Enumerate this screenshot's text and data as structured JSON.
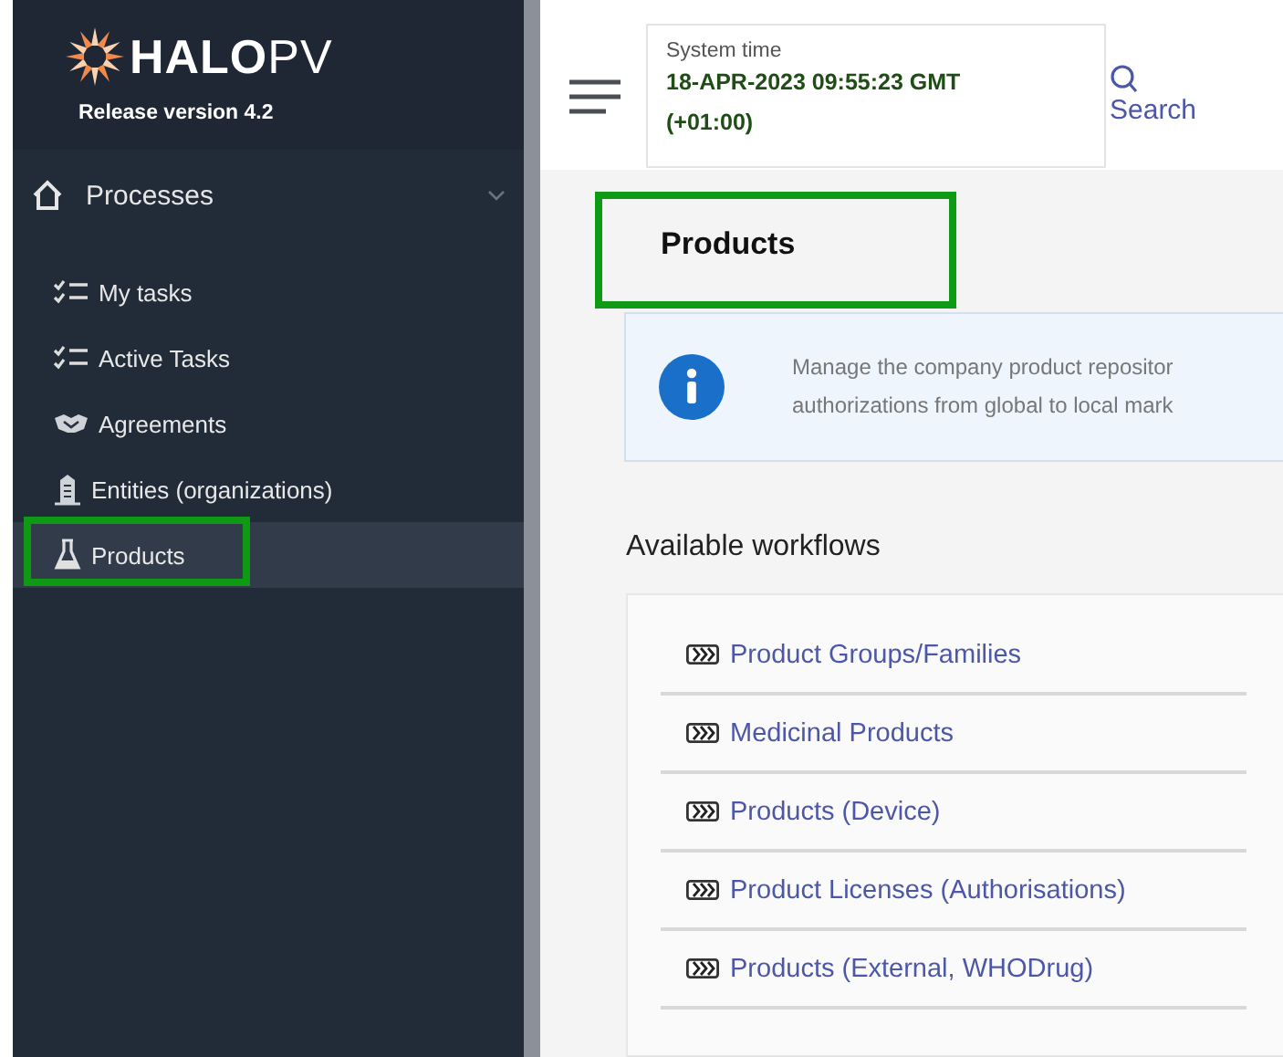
{
  "sidebar": {
    "logo": "**HALO**PV",
    "release": "Release version 4.2",
    "section": {
      "label": "Processes",
      "expanded": true
    },
    "items": [
      {
        "label": "My tasks",
        "kind": "tasks",
        "selected": false,
        "highlighted": false
      },
      {
        "label": "Active Tasks",
        "kind": "tasks",
        "selected": false,
        "highlighted": false
      },
      {
        "label": "Agreements",
        "kind": "handshake",
        "selected": false,
        "highlighted": false
      },
      {
        "label": "Entities (organizations)",
        "kind": "building",
        "selected": false,
        "highlighted": false
      },
      {
        "label": "Products",
        "kind": "flask",
        "selected": true,
        "highlighted": true
      }
    ]
  },
  "header": {
    "system_time_label": "System time",
    "system_time_lines": [
      "18-APR-2023 09:55:23 GMT",
      "(+01:00)"
    ],
    "search": "Search"
  },
  "page": {
    "title": "Products",
    "title_highlighted": true,
    "info_lines": [
      "Manage the company product repositor",
      "authorizations from global to local mark"
    ],
    "workflows_heading": "Available workflows",
    "workflows": [
      "Product Groups/Families",
      "Medicinal Products",
      "Products (Device)",
      "Product Licenses (Authorisations)",
      "Products (External, WHODrug)"
    ]
  }
}
